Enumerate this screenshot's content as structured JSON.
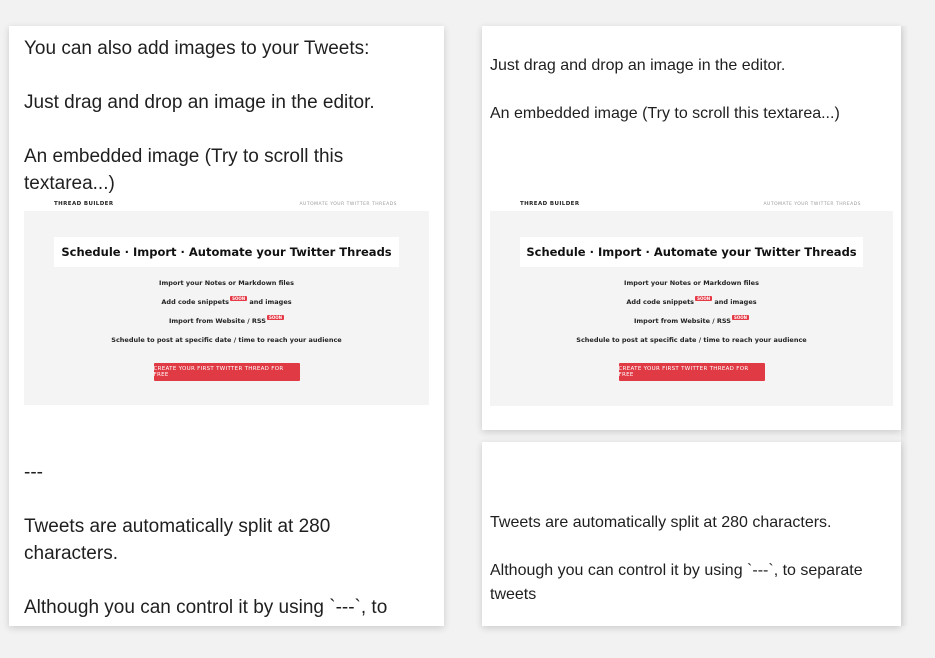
{
  "editor": {
    "lines": [
      "You can also add images to your Tweets:",
      "Just drag and drop an image in the editor.",
      "An embedded image (Try to scroll this",
      "textarea...)",
      "---",
      "Tweets are automatically split at 280",
      "characters.",
      "Although you can control it by using `---`, to"
    ]
  },
  "preview_image": {
    "brand": "THREAD BUILDER",
    "tagline": "AUTOMATE YOUR TWITTER THREADS",
    "headline": "Schedule · Import · Automate your Twitter Threads",
    "features": [
      "Import your Notes or Markdown files",
      "Add code snippets",
      "and images",
      "Import from Website / RSS",
      "Schedule to post at specific date / time to reach your audience"
    ],
    "soon_badge": "SOON",
    "cta": "CREATE YOUR FIRST TWITTER THREAD FOR FREE"
  },
  "tweet1": {
    "lines": [
      "Just drag and drop an image in the editor.",
      "An embedded image (Try to scroll this textarea...)"
    ]
  },
  "tweet2": {
    "lines": [
      "Tweets are automatically split at 280 characters.",
      "Although you can control it by using `---`, to separate",
      "tweets"
    ]
  },
  "colors": {
    "background": "#f2f2f2",
    "card": "#ffffff",
    "accent_red": "#e03a45"
  }
}
